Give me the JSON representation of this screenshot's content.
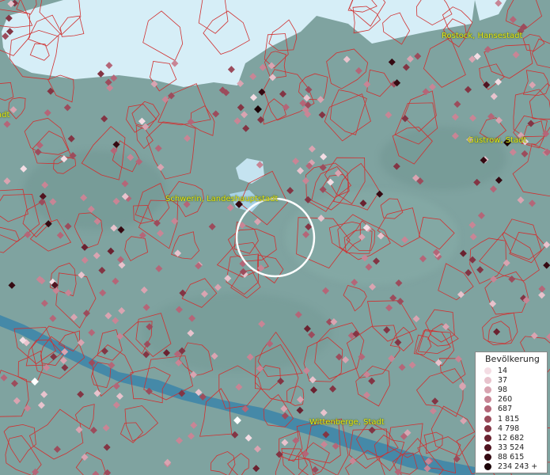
{
  "map": {
    "labels": [
      {
        "id": "rostock",
        "text": "Rostock, Hansestadt"
      },
      {
        "id": "guestrow",
        "text": "Güstrow, Stadt"
      },
      {
        "id": "schwerin",
        "text": "Schwerin, Landeshauptstadt"
      },
      {
        "id": "wittenberge",
        "text": "Wittenberge, Stadt"
      },
      {
        "id": "edge",
        "text": "adt"
      }
    ],
    "colors": {
      "land": "#7fa3a0",
      "water_sea": "#d6eef7",
      "water_river": "#3f86a8",
      "borders": "#d03030",
      "label_text": "#e8e619",
      "selection_circle": "#ffffff"
    }
  },
  "legend": {
    "title": "Bevölkerung",
    "items": [
      {
        "label": "14",
        "color": "#f4dde4"
      },
      {
        "label": "37",
        "color": "#e8c3cd"
      },
      {
        "label": "98",
        "color": "#d9a4b1"
      },
      {
        "label": "260",
        "color": "#c88595"
      },
      {
        "label": "687",
        "color": "#b46678"
      },
      {
        "label": "1 815",
        "color": "#9c4c5c"
      },
      {
        "label": "4 798",
        "color": "#833544"
      },
      {
        "label": "12 682",
        "color": "#6a2230"
      },
      {
        "label": "33 524",
        "color": "#501420"
      },
      {
        "label": "88 615",
        "color": "#350a12"
      },
      {
        "label": "234 243 +",
        "color": "#1c0408"
      }
    ]
  }
}
